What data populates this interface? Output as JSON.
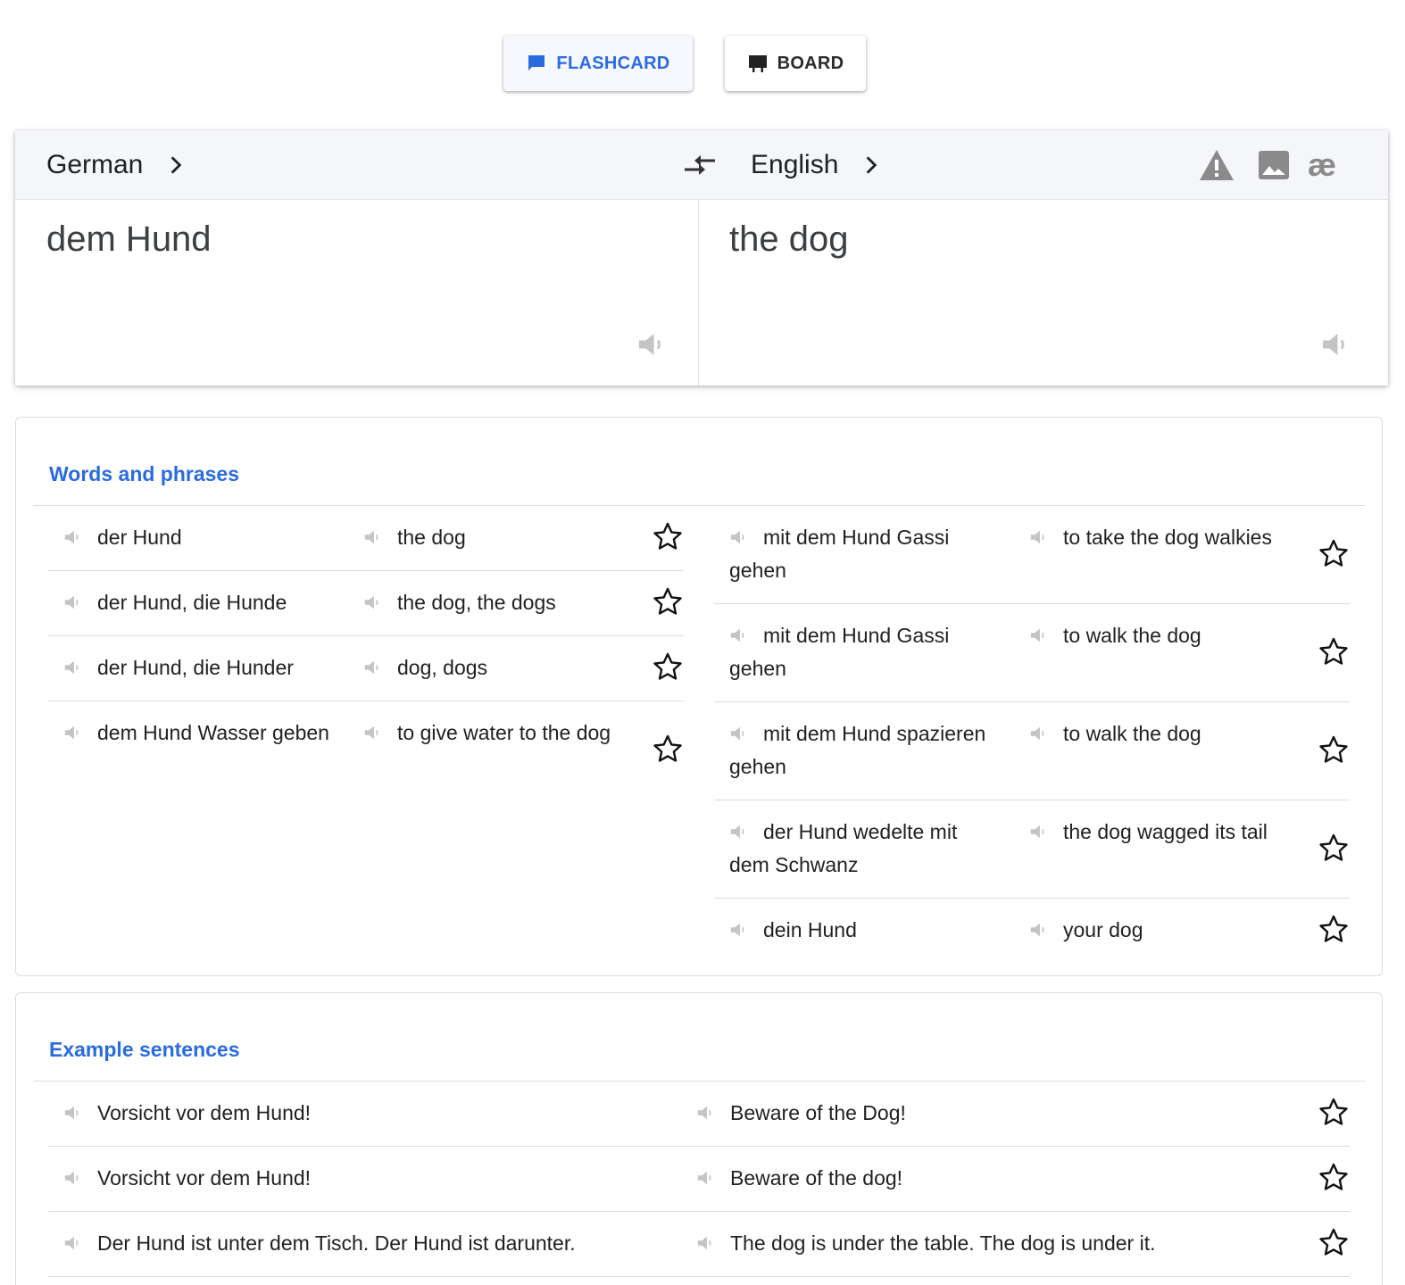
{
  "modes": {
    "flashcard": {
      "label": "FLASHCARD",
      "icon": "comment-icon",
      "active": true
    },
    "board": {
      "label": "BOARD",
      "icon": "easel-icon",
      "active": false
    }
  },
  "translator": {
    "source_lang": "German",
    "target_lang": "English",
    "source_text": "dem Hund",
    "target_text": "the dog",
    "tools": [
      "alert-icon",
      "image-icon",
      "phonetic-icon"
    ],
    "phonetic_glyph": "æ"
  },
  "words": {
    "title": "Words and phrases",
    "left": [
      {
        "src": "der Hund",
        "tgt": "the dog"
      },
      {
        "src": "der Hund, die Hunde",
        "tgt": "the dog, the dogs"
      },
      {
        "src": "der Hund, die Hunder",
        "tgt": "dog, dogs"
      },
      {
        "src": "dem Hund Wasser geben",
        "tgt": "to give water to the dog"
      }
    ],
    "right": [
      {
        "src": "mit dem Hund Gassi gehen",
        "tgt": "to take the dog walkies"
      },
      {
        "src": "mit dem Hund Gassi gehen",
        "tgt": "to walk the dog"
      },
      {
        "src": "mit dem Hund spazieren gehen",
        "tgt": "to walk the dog"
      },
      {
        "src": "der Hund wedelte mit dem Schwanz",
        "tgt": "the dog wagged its tail"
      },
      {
        "src": "dein Hund",
        "tgt": "your dog"
      }
    ]
  },
  "examples": {
    "title": "Example sentences",
    "rows": [
      {
        "src": "Vorsicht vor dem Hund!",
        "tgt": "Beware of the Dog!"
      },
      {
        "src": "Vorsicht vor dem Hund!",
        "tgt": "Beware of the dog!"
      },
      {
        "src": "Der Hund ist unter dem Tisch. Der Hund ist darunter.",
        "tgt": "The dog is under the table. The dog is under it."
      }
    ]
  },
  "colors": {
    "accent": "#2a6be0",
    "icon_grey": "#8a8a8a",
    "speaker_grey": "#c4c4c4"
  }
}
